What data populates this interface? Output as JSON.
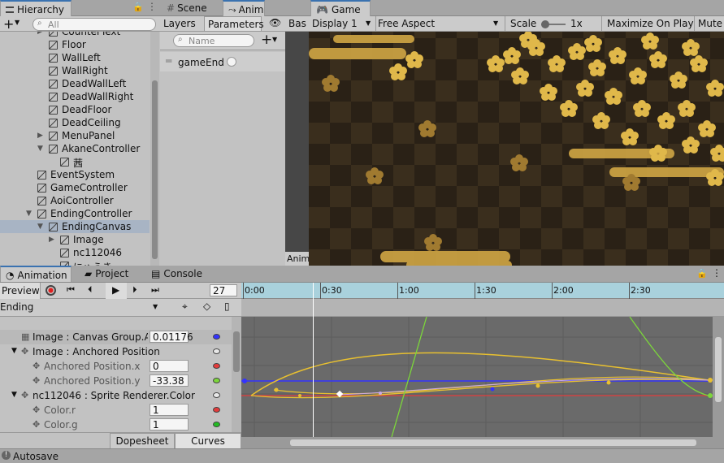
{
  "hierarchy": {
    "tab": "Hierarchy",
    "search_placeholder": "All",
    "items": [
      {
        "label": "CounterText",
        "indent": 1,
        "arrow": "▶",
        "sel": false
      },
      {
        "label": "Floor",
        "indent": 1,
        "arrow": "",
        "sel": false
      },
      {
        "label": "WallLeft",
        "indent": 1,
        "arrow": "",
        "sel": false
      },
      {
        "label": "WallRight",
        "indent": 1,
        "arrow": "",
        "sel": false
      },
      {
        "label": "DeadWallLeft",
        "indent": 1,
        "arrow": "",
        "sel": false
      },
      {
        "label": "DeadWallRight",
        "indent": 1,
        "arrow": "",
        "sel": false
      },
      {
        "label": "DeadFloor",
        "indent": 1,
        "arrow": "",
        "sel": false
      },
      {
        "label": "DeadCeiling",
        "indent": 1,
        "arrow": "",
        "sel": false
      },
      {
        "label": "MenuPanel",
        "indent": 1,
        "arrow": "▶",
        "sel": false
      },
      {
        "label": "AkaneController",
        "indent": 1,
        "arrow": "▼",
        "sel": false
      },
      {
        "label": "茜",
        "indent": 2,
        "arrow": "",
        "sel": false
      },
      {
        "label": "EventSystem",
        "indent": 0,
        "arrow": "",
        "sel": false
      },
      {
        "label": "GameController",
        "indent": 0,
        "arrow": "",
        "sel": false
      },
      {
        "label": "AoiController",
        "indent": 0,
        "arrow": "",
        "sel": false
      },
      {
        "label": "EndingController",
        "indent": 0,
        "arrow": "▼",
        "sel": false
      },
      {
        "label": "EndingCanvas",
        "indent": 1,
        "arrow": "▼",
        "sel": true
      },
      {
        "label": "Image",
        "indent": 2,
        "arrow": "▶",
        "sel": false
      },
      {
        "label": "nc112046",
        "indent": 2,
        "arrow": "",
        "sel": false
      },
      {
        "label": "にゅうき",
        "indent": 2,
        "arrow": "",
        "sel": false
      }
    ]
  },
  "animator": {
    "tabs": [
      "Scene",
      "Animator"
    ],
    "subtabs": [
      "Layers",
      "Parameters"
    ],
    "search_placeholder": "Name",
    "param": "gameEnd",
    "base_label": "Bas",
    "anim_label": "Anima"
  },
  "game": {
    "tab": "Game",
    "display": "Display 1",
    "aspect": "Free Aspect",
    "scale_label": "Scale",
    "scale_value": "1x",
    "maximize": "Maximize On Play",
    "mute": "Mute"
  },
  "animation": {
    "tabs": [
      "Animation",
      "Project",
      "Console"
    ],
    "preview": "Preview",
    "frame": "27",
    "clip": "Ending",
    "timeline": [
      "0:00",
      "0:30",
      "1:00",
      "1:30",
      "2:00",
      "2:30"
    ],
    "properties": [
      {
        "label": "Image : Canvas Group.Alpha",
        "value": "0.01176",
        "dot": "#3333ff",
        "indent": 1,
        "type": "prop"
      },
      {
        "label": "Image : Anchored Position",
        "value": "",
        "dot": "#e8e8e8",
        "indent": 0,
        "type": "group"
      },
      {
        "label": "Anchored Position.x",
        "value": "0",
        "dot": "#e23b3b",
        "indent": 2,
        "type": "sub"
      },
      {
        "label": "Anchored Position.y",
        "value": "-33.38",
        "dot": "#7cd63b",
        "indent": 2,
        "type": "sub"
      },
      {
        "label": "nc112046 : Sprite Renderer.Color",
        "value": "",
        "dot": "#e8e8e8",
        "indent": 0,
        "type": "group"
      },
      {
        "label": "Color.r",
        "value": "1",
        "dot": "#e23b3b",
        "indent": 2,
        "type": "sub"
      },
      {
        "label": "Color.g",
        "value": "1",
        "dot": "#22bb22",
        "indent": 2,
        "type": "sub"
      }
    ],
    "bottom_tabs": [
      "Dopesheet",
      "Curves"
    ]
  },
  "status": {
    "text": "Autosave"
  },
  "colors": {
    "accent": "#3a72b0",
    "timeline": "#a9d1dc",
    "curve_area": "#6a6a6a"
  }
}
